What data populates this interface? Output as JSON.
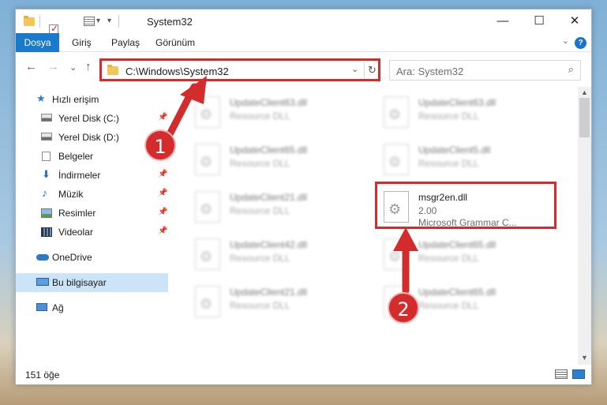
{
  "window": {
    "title": "System32",
    "minimize_glyph": "—",
    "maximize_glyph": "☐",
    "close_glyph": "✕"
  },
  "quick_access": {
    "dropdown_glyph": "▾"
  },
  "ribbon": {
    "tabs": [
      "Dosya",
      "Giriş",
      "Paylaş",
      "Görünüm"
    ],
    "expand_glyph": "⌄",
    "help_glyph": "?"
  },
  "nav": {
    "back_glyph": "←",
    "forward_glyph": "→",
    "recent_glyph": "⌄",
    "up_glyph": "↑",
    "address": "C:\\Windows\\System32",
    "address_dropdown_glyph": "⌄",
    "refresh_glyph": "↻",
    "search_placeholder": "Ara: System32",
    "search_glyph": "⌕"
  },
  "sidebar": {
    "pin_glyph": "📌",
    "items": [
      {
        "label": "Hızlı erişim",
        "icon": "star-icon",
        "pinned": false
      },
      {
        "label": "Yerel Disk (C:)",
        "icon": "drive-icon",
        "pinned": true
      },
      {
        "label": "Yerel Disk (D:)",
        "icon": "drive-icon",
        "pinned": false
      },
      {
        "label": "Belgeler",
        "icon": "document-icon",
        "pinned": false
      },
      {
        "label": "İndirmeler",
        "icon": "download-icon",
        "pinned": true
      },
      {
        "label": "Müzik",
        "icon": "music-icon",
        "pinned": true
      },
      {
        "label": "Resimler",
        "icon": "picture-icon",
        "pinned": true
      },
      {
        "label": "Videolar",
        "icon": "video-icon",
        "pinned": true
      },
      {
        "label": "OneDrive",
        "icon": "cloud-icon",
        "pinned": false
      },
      {
        "label": "Bu bilgisayar",
        "icon": "computer-icon",
        "pinned": false,
        "selected": true
      },
      {
        "label": "Ağ",
        "icon": "network-icon",
        "pinned": false
      }
    ]
  },
  "files": {
    "left_column": [
      {
        "name": "UpdateClient63.dll",
        "desc": "Resource DLL"
      },
      {
        "name": "UpdateClient65.dll",
        "desc": "Resource DLL"
      },
      {
        "name": "UpdateClient21.dll",
        "desc": "Resource DLL"
      },
      {
        "name": "UpdateClient42.dll",
        "desc": "Resource DLL"
      },
      {
        "name": "UpdateClient21.dll",
        "desc": "Resource DLL"
      }
    ],
    "right_column": [
      {
        "name": "UpdateClient63.dll",
        "desc": "Resource DLL"
      },
      {
        "name": "UpdateClient5.dll",
        "desc": "Resource DLL"
      },
      {
        "name": "msgr2en.dll",
        "desc": "2.00",
        "desc2": "Microsoft Grammar C...",
        "highlighted": true
      },
      {
        "name": "UpdateClient65.dll",
        "desc": "Resource DLL"
      },
      {
        "name": "UpdateClient65.dll",
        "desc": "Resource DLL"
      }
    ]
  },
  "scrollbar": {
    "up_glyph": "▲",
    "down_glyph": "▼"
  },
  "status": {
    "count": "151 öğe"
  },
  "callouts": [
    {
      "number": "1"
    },
    {
      "number": "2"
    }
  ],
  "colors": {
    "accent": "#1979ca",
    "highlight": "#d32c2c",
    "selection": "#cce4f7"
  }
}
